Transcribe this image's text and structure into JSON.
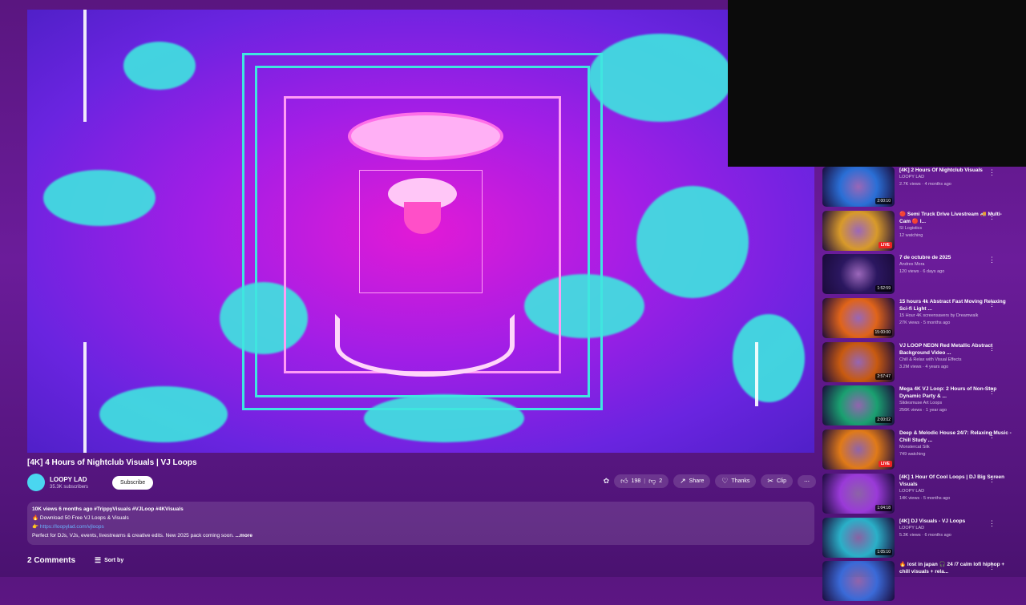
{
  "video": {
    "title": "[4K] 4 Hours of Nightclub Visuals | VJ Loops",
    "channel": "LOOPY LAD",
    "subscribers": "35.3K subscribers",
    "subscribe_label": "Subscribe"
  },
  "actions": {
    "likes": "198",
    "dislikes": "2",
    "share": "Share",
    "thanks": "Thanks",
    "clip": "Clip",
    "more": "⋯"
  },
  "description": {
    "meta": "10K views  6 months ago  #TrippyVisuals #VJLoop #4KVisuals",
    "line1": "🔥 Download 50 Free VJ Loops & Visuals",
    "link": "👉 https://loopylad.com/vjloops",
    "line3": "Perfect for DJs, VJs, events, livestreams & creative edits. New 2025 pack coming soon.",
    "more": "...more"
  },
  "comments": {
    "count_label": "2 Comments",
    "sort_label": "Sort by"
  },
  "recommendations": [
    {
      "title": "[4K] 2 Hours Of Nightclub Visuals",
      "channel": "LOOPY LAD",
      "stats": "2.7K views · 4 months ago",
      "badge": "2:00:10",
      "live": false,
      "color": "#2a6fd6"
    },
    {
      "title": "🔴 Semi Truck Drive Livestream 🚚 Multi-Cam 🔴 I...",
      "channel": "SI Logistics",
      "stats": "12 watching",
      "badge": "LIVE",
      "live": true,
      "color": "#d89a2a"
    },
    {
      "title": "7 de octubre de 2025",
      "channel": "Andres Mora",
      "stats": "120 views · 6 days ago",
      "badge": "1:52:59",
      "live": false,
      "color": "#2b1760"
    },
    {
      "title": "15 hours 4k Abstract Fast Moving Relaxing Sci-fi Light ...",
      "channel": "15 Hour 4K screensavers by Dreamwalk",
      "stats": "27K views · 5 months ago",
      "badge": "15:00:00",
      "live": false,
      "color": "#e0641a"
    },
    {
      "title": "VJ LOOP NEON Red Metallic Abstract Background Video ...",
      "channel": "Chill & Relax with Visual Effects",
      "stats": "3.2M views · 4 years ago",
      "badge": "2:57:47",
      "live": false,
      "color": "#c85a10"
    },
    {
      "title": "Mega 4K VJ Loop: 2 Hours of Non-Stop Dynamic Party & ...",
      "channel": "Slidesmuse Art Loops",
      "stats": "256K views · 1 year ago",
      "badge": "2:00:02",
      "live": false,
      "color": "#1aa070"
    },
    {
      "title": "Deep & Melodic House 24/7: Relaxing Music - Chill Study ...",
      "channel": "Monstercat Silk",
      "stats": "749 watching",
      "badge": "LIVE",
      "live": true,
      "color": "#e07a18"
    },
    {
      "title": "[4K] 1 Hour Of Cool Loops | DJ Big Screen Visuals",
      "channel": "LOOPY LAD",
      "stats": "14K views · 5 months ago",
      "badge": "1:04:18",
      "live": false,
      "color": "#9a3ad8"
    },
    {
      "title": "[4K] DJ Visuals - VJ Loops",
      "channel": "LOOPY LAD",
      "stats": "5.3K views · 6 months ago",
      "badge": "1:05:10",
      "live": false,
      "color": "#2ab0c8"
    },
    {
      "title": "🔥 lost in japan 🎧 24 /7 calm lofi hiphop + chill visuals + rela...",
      "channel": "",
      "stats": "",
      "badge": "",
      "live": false,
      "color": "#3a6ad8"
    }
  ]
}
